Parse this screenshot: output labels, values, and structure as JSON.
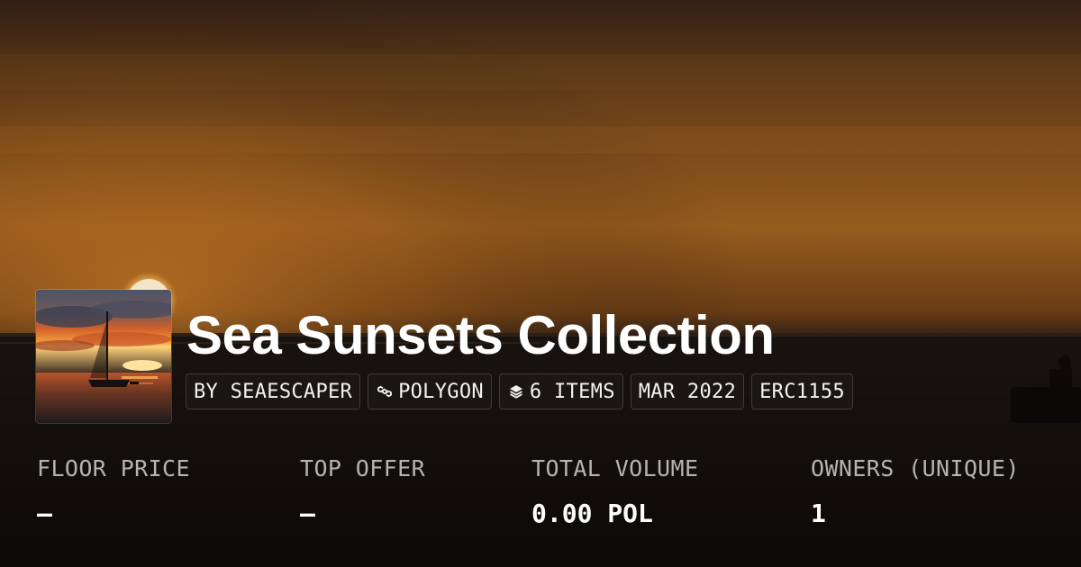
{
  "collection": {
    "title": "Sea Sunsets Collection"
  },
  "tags": [
    {
      "label": "BY SEAESCAPER",
      "icon": ""
    },
    {
      "label": "POLYGON",
      "icon": "polygon-chain-icon"
    },
    {
      "label": "6 ITEMS",
      "icon": "layers-icon"
    },
    {
      "label": "MAR 2022",
      "icon": ""
    },
    {
      "label": "ERC1155",
      "icon": ""
    }
  ],
  "stats": [
    {
      "label": "FLOOR PRICE",
      "value": "–"
    },
    {
      "label": "TOP OFFER",
      "value": "–"
    },
    {
      "label": "TOTAL VOLUME",
      "value": "0.00 POL"
    },
    {
      "label": "OWNERS (UNIQUE)",
      "value": "1"
    }
  ],
  "colors": {
    "sky_top": "#3a2414",
    "sky_glow": "#a8651f",
    "sea": "#1a1512",
    "text_primary": "#ffffff",
    "text_muted": "#b4b4b4"
  }
}
